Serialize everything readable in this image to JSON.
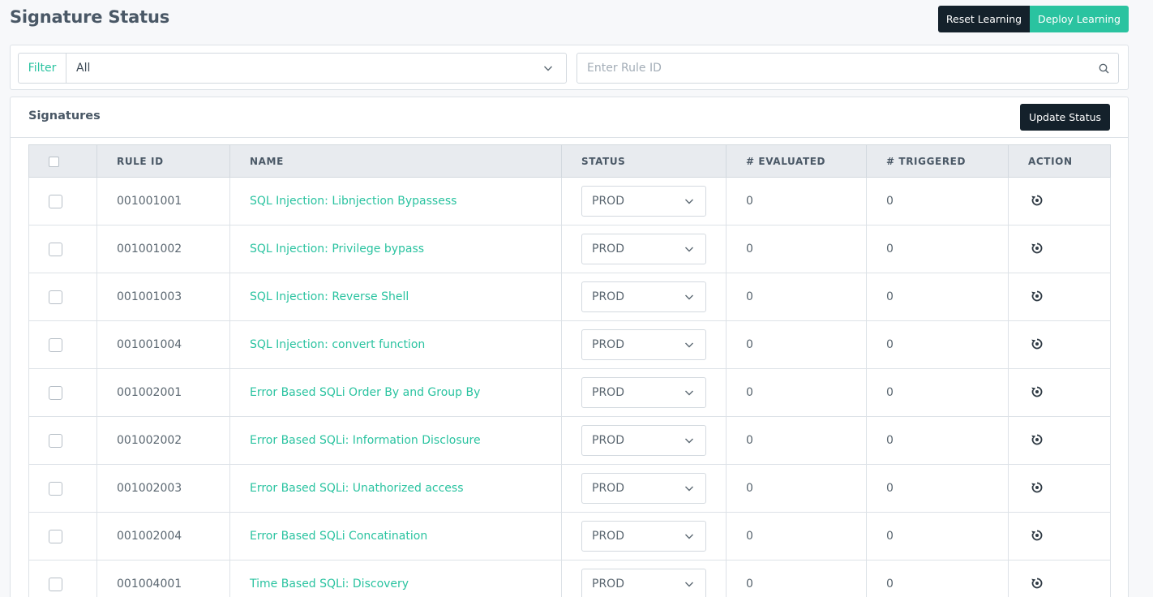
{
  "page": {
    "title": "Signature Status"
  },
  "header_buttons": {
    "reset_label": "Reset Learning",
    "deploy_label": "Deploy Learning"
  },
  "filter": {
    "label": "Filter",
    "selected": "All",
    "search_placeholder": "Enter Rule ID"
  },
  "signatures": {
    "title": "Signatures",
    "update_label": "Update Status",
    "columns": [
      "RULE ID",
      "NAME",
      "STATUS",
      "# EVALUATED",
      "# TRIGGERED",
      "ACTION"
    ],
    "rows": [
      {
        "rule_id": "001001001",
        "name": "SQL Injection: Libnjection Bypassess",
        "status": "PROD",
        "evaluated": "0",
        "triggered": "0"
      },
      {
        "rule_id": "001001002",
        "name": "SQL Injection: Privilege bypass",
        "status": "PROD",
        "evaluated": "0",
        "triggered": "0"
      },
      {
        "rule_id": "001001003",
        "name": "SQL Injection: Reverse Shell",
        "status": "PROD",
        "evaluated": "0",
        "triggered": "0"
      },
      {
        "rule_id": "001001004",
        "name": "SQL Injection: convert function",
        "status": "PROD",
        "evaluated": "0",
        "triggered": "0"
      },
      {
        "rule_id": "001002001",
        "name": "Error Based SQLi Order By and Group By",
        "status": "PROD",
        "evaluated": "0",
        "triggered": "0"
      },
      {
        "rule_id": "001002002",
        "name": "Error Based SQLi: Information Disclosure",
        "status": "PROD",
        "evaluated": "0",
        "triggered": "0"
      },
      {
        "rule_id": "001002003",
        "name": "Error Based SQLi: Unathorized access",
        "status": "PROD",
        "evaluated": "0",
        "triggered": "0"
      },
      {
        "rule_id": "001002004",
        "name": "Error Based SQLi Concatination",
        "status": "PROD",
        "evaluated": "0",
        "triggered": "0"
      },
      {
        "rule_id": "001004001",
        "name": "Time Based SQLi: Discovery",
        "status": "PROD",
        "evaluated": "0",
        "triggered": "0"
      }
    ]
  },
  "icons": {
    "dropdown": "chevron-down-icon",
    "search": "search-icon",
    "action": "reset-icon"
  },
  "colors": {
    "accent": "#2ac3a0",
    "dark_button": "#14212b"
  }
}
